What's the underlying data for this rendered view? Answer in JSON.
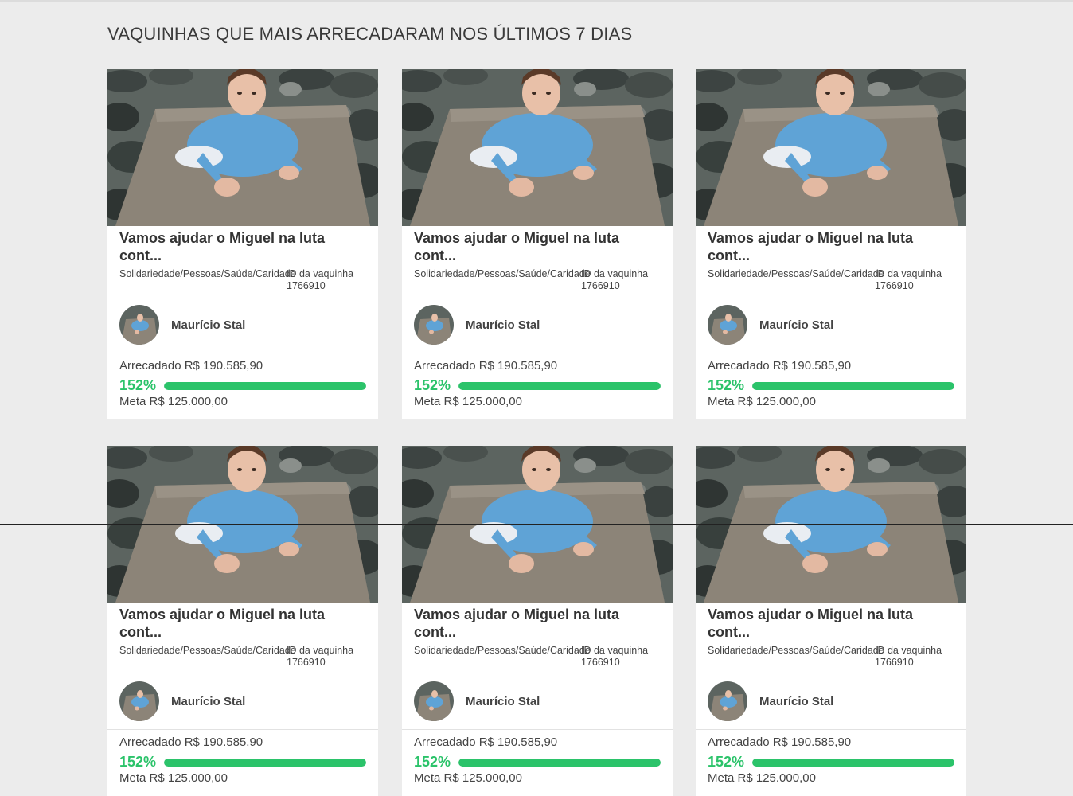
{
  "section": {
    "title": "VAQUINHAS QUE MAIS ARRECADARAM NOS ÚLTIMOS 7 DIAS"
  },
  "cards": [
    {
      "title": "Vamos ajudar o Miguel na luta cont...",
      "categories": "Solidariedade/Pessoas/Saúde/Caridade",
      "id_label": "ID da vaquinha 1766910",
      "author": "Maurício Stal",
      "raised": "Arrecadado R$ 190.585,90",
      "percent_label": "152%",
      "percent": 152,
      "goal": "Meta R$ 125.000,00"
    },
    {
      "title": "Vamos ajudar o Miguel na luta cont...",
      "categories": "Solidariedade/Pessoas/Saúde/Caridade",
      "id_label": "ID da vaquinha 1766910",
      "author": "Maurício Stal",
      "raised": "Arrecadado R$ 190.585,90",
      "percent_label": "152%",
      "percent": 152,
      "goal": "Meta R$ 125.000,00"
    },
    {
      "title": "Vamos ajudar o Miguel na luta cont...",
      "categories": "Solidariedade/Pessoas/Saúde/Caridade",
      "id_label": "ID da vaquinha 1766910",
      "author": "Maurício Stal",
      "raised": "Arrecadado R$ 190.585,90",
      "percent_label": "152%",
      "percent": 152,
      "goal": "Meta R$ 125.000,00"
    }
  ],
  "colors": {
    "accent_green": "#2bc36a",
    "page_background": "#ececec",
    "card_background": "#ffffff"
  }
}
